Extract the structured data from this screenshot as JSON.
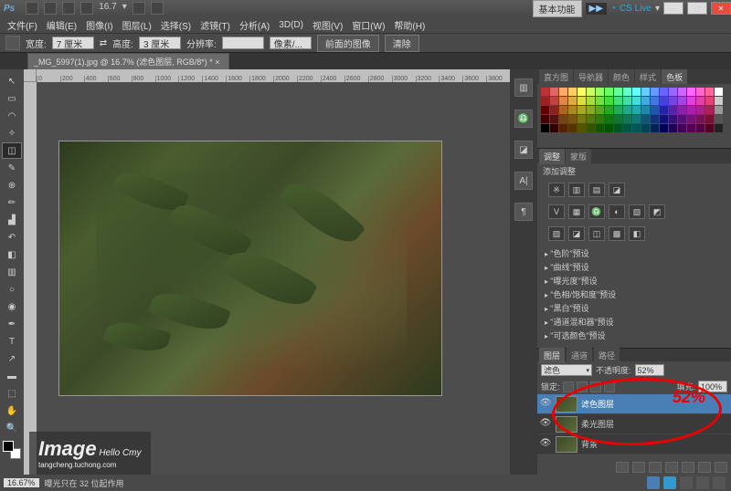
{
  "title": {
    "basic": "基本功能",
    "cslive": "CS Live"
  },
  "menu": [
    "文件(F)",
    "编辑(E)",
    "图像(I)",
    "图层(L)",
    "选择(S)",
    "滤镜(T)",
    "分析(A)",
    "3D(D)",
    "视图(V)",
    "窗口(W)",
    "帮助(H)"
  ],
  "zoom_title": "16.7",
  "options": {
    "width_lbl": "宽度:",
    "width_val": "7 厘米",
    "height_lbl": "高度:",
    "height_val": "3 厘米",
    "res_lbl": "分辨率:",
    "res_val": "",
    "res_unit": "像素/...",
    "front_img": "前面的图像",
    "clear": "清除"
  },
  "doctab": "_MG_5997(1).jpg @ 16.7% (滤色图层, RGB/8*) * ×",
  "ruler": [
    "0",
    "200",
    "400",
    "600",
    "800",
    "1000",
    "1200",
    "1400",
    "1600",
    "1800",
    "2000",
    "2200",
    "2400",
    "2600",
    "2800",
    "3000",
    "3200",
    "3400",
    "3600",
    "3800"
  ],
  "watermark": {
    "big": "Image",
    "line1": "Hello Cmy",
    "line2": "tangcheng.tuchong.com"
  },
  "color_tabs": [
    "直方图",
    "导航器",
    "颜色",
    "样式",
    "色板"
  ],
  "adjust": {
    "tabs": [
      "调整",
      "蒙版"
    ],
    "head": "添加调整",
    "row1": [
      "※",
      "▥",
      "▤",
      "◪"
    ],
    "row2": [
      "V",
      "▦",
      "♎",
      "◐",
      "▧",
      "◩"
    ],
    "row3": [
      "▨",
      "◪",
      "◫",
      "▩",
      "◧"
    ],
    "presets": [
      "\"色阶\"预设",
      "\"曲线\"预设",
      "\"曝光度\"预设",
      "\"色相/饱和度\"预设",
      "\"黑白\"预设",
      "\"通道混和器\"预设",
      "\"可选颜色\"预设"
    ]
  },
  "layers": {
    "tabs": [
      "图层",
      "通道",
      "路径"
    ],
    "blend": "滤色",
    "opacity_lbl": "不透明度:",
    "opacity_val": "52%",
    "lock_lbl": "锁定:",
    "fill_lbl": "填充:",
    "fill_val": "100%",
    "rows": [
      {
        "name": "滤色图层",
        "sel": true
      },
      {
        "name": "柔光图层",
        "sel": false
      },
      {
        "name": "背景",
        "sel": false
      }
    ]
  },
  "annotation": "52%",
  "status": {
    "zoom": "16.67%",
    "info": "曝光只在 32 位起作用"
  },
  "swatch_colors": [
    "#b33",
    "#d66",
    "#fa6",
    "#fc6",
    "#ff6",
    "#cf6",
    "#9f6",
    "#6f6",
    "#6f9",
    "#6fc",
    "#6ff",
    "#6cf",
    "#69f",
    "#66f",
    "#96f",
    "#c6f",
    "#f6f",
    "#f6c",
    "#f69",
    "#fff",
    "#922",
    "#b44",
    "#d84",
    "#da4",
    "#dd4",
    "#ad4",
    "#7d4",
    "#4d4",
    "#4d7",
    "#4da",
    "#4dd",
    "#4ad",
    "#47d",
    "#44d",
    "#74d",
    "#a4d",
    "#d4d",
    "#d4a",
    "#d47",
    "#ccc",
    "#600",
    "#822",
    "#a62",
    "#a82",
    "#aa2",
    "#8a2",
    "#5a2",
    "#2a2",
    "#2a5",
    "#2a8",
    "#2aa",
    "#28a",
    "#25a",
    "#22a",
    "#52a",
    "#82a",
    "#a2a",
    "#a28",
    "#a25",
    "#999",
    "#400",
    "#511",
    "#741",
    "#751",
    "#771",
    "#571",
    "#371",
    "#171",
    "#173",
    "#175",
    "#177",
    "#157",
    "#137",
    "#117",
    "#317",
    "#517",
    "#717",
    "#715",
    "#713",
    "#555",
    "#000",
    "#300",
    "#520",
    "#530",
    "#550",
    "#350",
    "#150",
    "#050",
    "#052",
    "#054",
    "#055",
    "#045",
    "#025",
    "#005",
    "#205",
    "#405",
    "#505",
    "#504",
    "#502",
    "#222"
  ]
}
